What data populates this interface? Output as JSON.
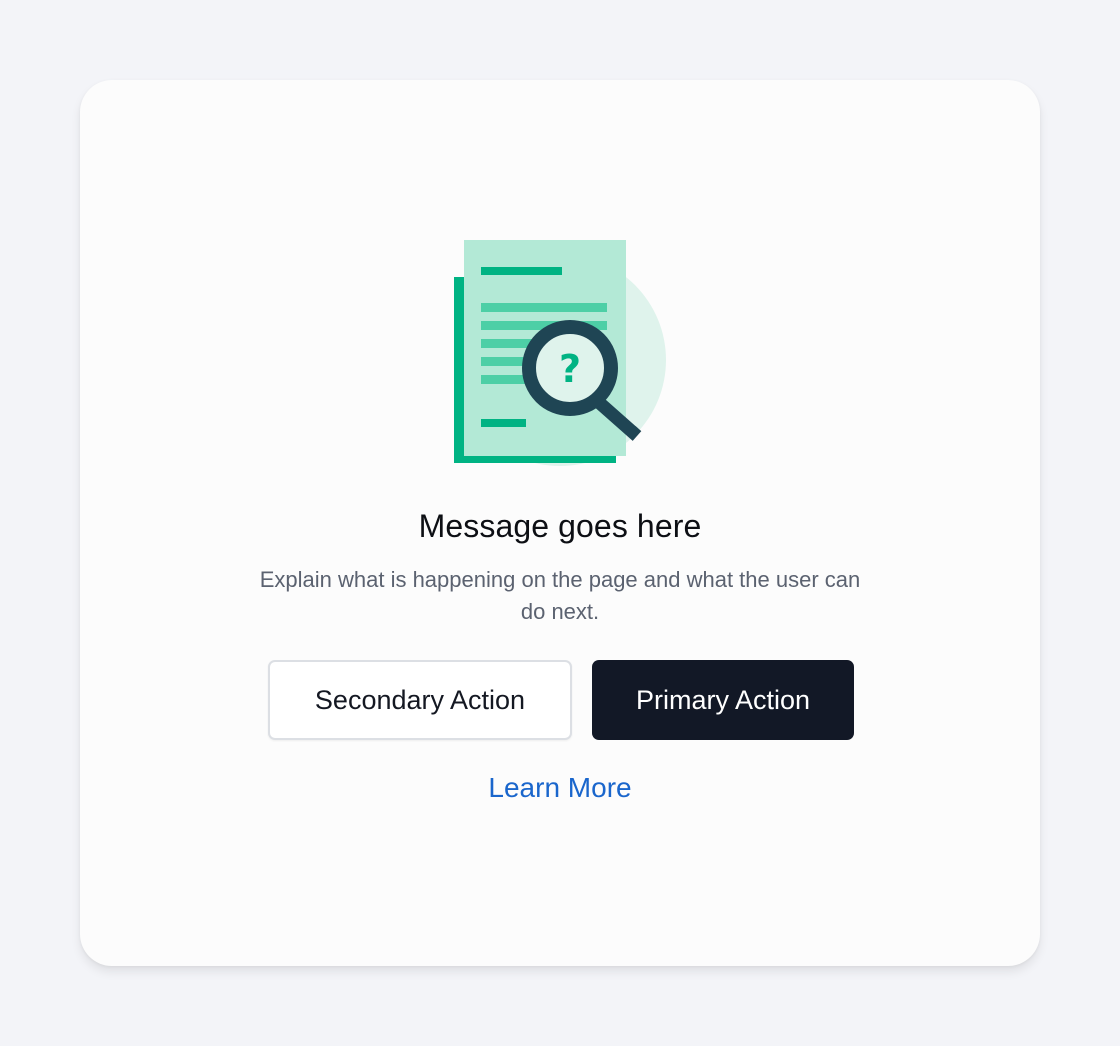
{
  "empty_state": {
    "illustration": {
      "icon": "document-search-icon",
      "glyph": "?",
      "colors": {
        "circle": "#dff3ec",
        "page_back": "#00b383",
        "page_front": "#b3e9d6",
        "lines_dark": "#00b383",
        "lines_light": "#4dcfa6",
        "magnifier": "#1f4554"
      }
    },
    "title": "Message goes here",
    "description": "Explain what is happening on the page and what the user can do next.",
    "secondary_button": "Secondary Action",
    "primary_button": "Primary Action",
    "link": "Learn More",
    "colors": {
      "background": "#f3f4f8",
      "card": "#fcfcfc",
      "primary_button": "#121826",
      "link": "#1a66cc"
    }
  }
}
